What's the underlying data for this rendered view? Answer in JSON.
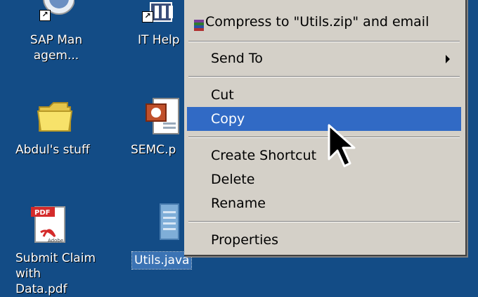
{
  "desktop": {
    "icons": [
      {
        "label": "SAP Managem..."
      },
      {
        "label": "IT Help"
      },
      {
        "label": "Abdul's stuff"
      },
      {
        "label": "SEMC.p"
      },
      {
        "label": "Submit Claim with Data.pdf"
      },
      {
        "label": "Utils.java"
      }
    ]
  },
  "context_menu": {
    "items": [
      {
        "label": "Compress to \"Utils.zip\" and email",
        "icon": "winrar-archive-icon"
      },
      {
        "label": "Send To",
        "icon": "chevron-right-icon"
      },
      {
        "label": "Cut"
      },
      {
        "label": "Copy",
        "highlighted": true
      },
      {
        "label": "Create Shortcut"
      },
      {
        "label": "Delete"
      },
      {
        "label": "Rename"
      },
      {
        "label": "Properties"
      }
    ]
  },
  "colors": {
    "desktop_bg": "#134c86",
    "menu_bg": "#d4d0c8",
    "highlight": "#316ac5",
    "selection": "#3b73b4"
  }
}
